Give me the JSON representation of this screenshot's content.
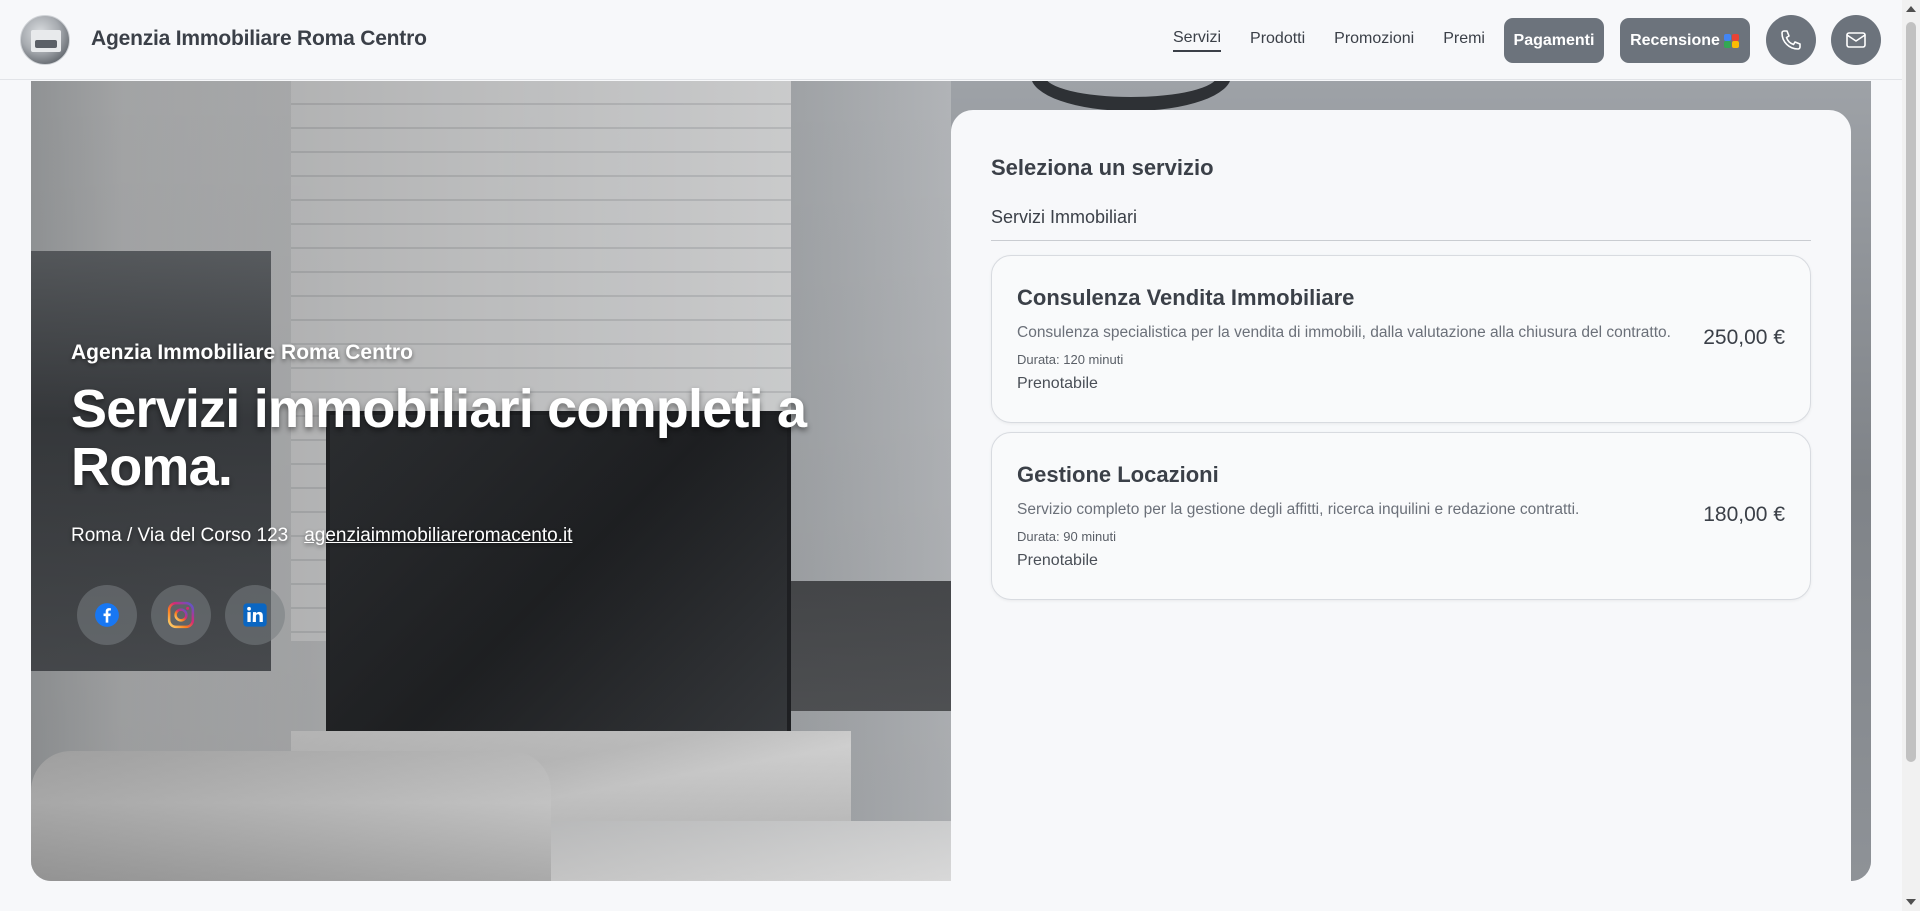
{
  "header": {
    "brand": "Agenzia Immobiliare Roma Centro",
    "nav": [
      "Servizi",
      "Prodotti",
      "Promozioni",
      "Premi"
    ],
    "active_nav": "Servizi",
    "pay_label": "Pagamenti",
    "review_label": "Recensione",
    "icons": [
      "logo-image",
      "phone-icon",
      "mail-icon"
    ]
  },
  "hero": {
    "agency_name": "Agenzia Immobiliare Roma Centro",
    "title": "Servizi immobiliari completi a Roma.",
    "address": "Roma / Via del Corso 123",
    "website": "agenziaimmobiliareromacento.it",
    "socials": [
      "facebook-icon",
      "instagram-icon",
      "linkedin-icon"
    ]
  },
  "services": {
    "heading": "Seleziona un servizio",
    "category": "Servizi Immobiliari",
    "items": [
      {
        "name": "Consulenza Vendita Immobiliare",
        "description": "Consulenza specialistica per la vendita di immobili, dalla valutazione alla chiusura del contratto.",
        "duration": "Durata: 120 minuti",
        "status": "Prenotabile",
        "price": "250,00 €"
      },
      {
        "name": "Gestione Locazioni",
        "description": "Servizio completo per la gestione degli affitti, ricerca inquilini e redazione contratti.",
        "duration": "Durata: 90 minuti",
        "status": "Prenotabile",
        "price": "180,00 €"
      }
    ]
  },
  "colors": {
    "accent": "#6c737c",
    "text": "#3b4048",
    "background": "#f7f8fa"
  }
}
